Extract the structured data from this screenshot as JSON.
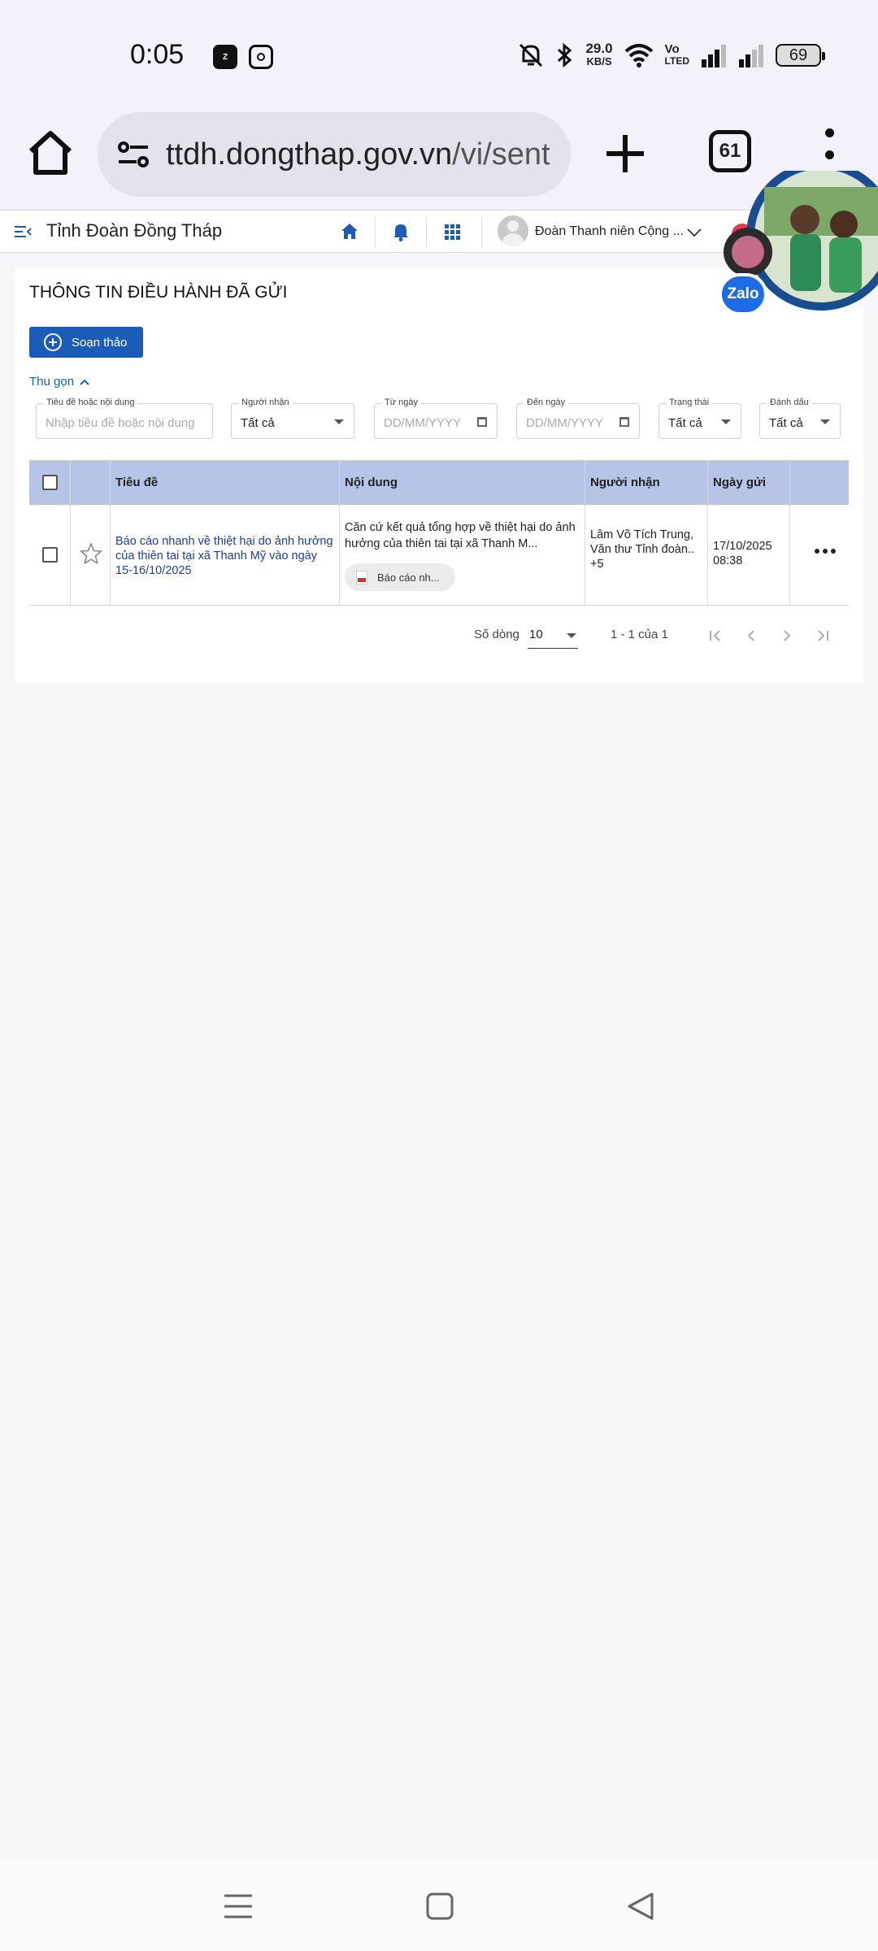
{
  "status_bar": {
    "time": "0:05",
    "app_icons": [
      "zalo-icon",
      "instagram-icon"
    ],
    "net_speed_value": "29.0",
    "net_speed_unit": "KB/S",
    "volte_line1": "Vo",
    "volte_line2": "LTED",
    "battery": "69"
  },
  "browser": {
    "url_host": "ttdh.dongthap.gov.vn",
    "url_path": "/vi/sent",
    "tab_count": "61"
  },
  "header": {
    "org_title": "Tỉnh Đoàn Đồng Tháp",
    "user_name": "Đoàn Thanh niên Cộng ..."
  },
  "page": {
    "title": "THÔNG TIN ĐIỀU HÀNH ĐÃ GỬI",
    "compose_label": "Soạn thảo",
    "collapse_label": "Thu gọn"
  },
  "filters": {
    "search": {
      "label": "Tiêu đề hoặc nội dung",
      "placeholder": "Nhập tiêu đề hoặc nội dung"
    },
    "recipient": {
      "label": "Người nhận",
      "value": "Tất cả"
    },
    "from_date": {
      "label": "Từ ngày",
      "placeholder": "DD/MM/YYYY"
    },
    "to_date": {
      "label": "Đến ngày",
      "placeholder": "DD/MM/YYYY"
    },
    "status": {
      "label": "Trạng thái",
      "value": "Tất cả"
    },
    "flag": {
      "label": "Đánh dấu",
      "value": "Tất cả"
    }
  },
  "table": {
    "columns": [
      "",
      "",
      "Tiêu đề",
      "Nội dung",
      "Người nhận",
      "Ngày gửi",
      ""
    ],
    "rows": [
      {
        "title": "Báo cáo nhanh về thiệt hại do ảnh hưởng của thiên tai tại xã Thanh Mỹ vào ngày 15-16/10/2025",
        "content": "Căn cứ kết quả tổng hợp về thiệt hại do ảnh hưởng của thiên tai tại xã Thanh M...",
        "attachment": "Báo cáo nh...",
        "recipient_line1": "Lâm Võ Tích Trung,",
        "recipient_line2": "Văn thư Tỉnh đoàn..",
        "recipient_more": "+5",
        "date": "17/10/2025",
        "time": "08:38"
      }
    ]
  },
  "pagination": {
    "rows_label": "Số dòng",
    "rows_value": "10",
    "range": "1 - 1 của 1"
  },
  "floating": {
    "zalo_label": "Zalo"
  },
  "colors": {
    "primary": "#1a5cb8",
    "table_header": "#b6c4e8",
    "accent_red": "#e8384f"
  }
}
